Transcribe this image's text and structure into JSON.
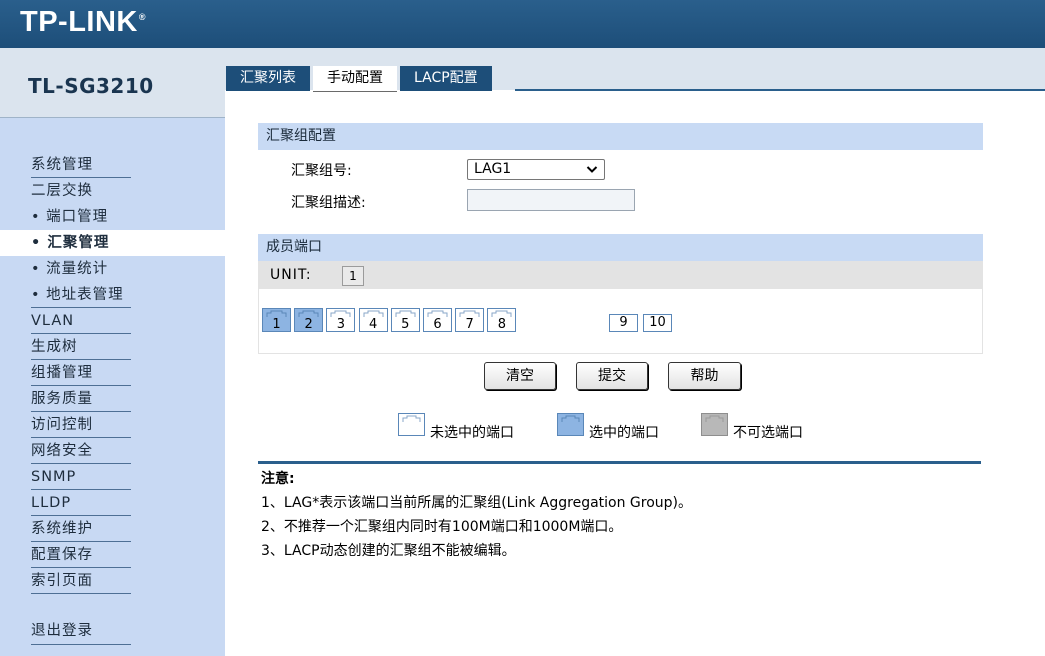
{
  "header": {
    "logo": "TP-LINK",
    "logo_mark": "®",
    "bg_color": "#1d4e79"
  },
  "device": {
    "model": "TL-SG3210"
  },
  "sidebar": {
    "items": [
      {
        "label": "系统管理"
      },
      {
        "label": "二层交换"
      },
      {
        "label": "端口管理",
        "sub": true
      },
      {
        "label": "汇聚管理",
        "sub": true,
        "active": true
      },
      {
        "label": "流量统计",
        "sub": true
      },
      {
        "label": "地址表管理",
        "sub": true
      },
      {
        "label": "VLAN"
      },
      {
        "label": "生成树"
      },
      {
        "label": "组播管理"
      },
      {
        "label": "服务质量"
      },
      {
        "label": "访问控制"
      },
      {
        "label": "网络安全"
      },
      {
        "label": "SNMP"
      },
      {
        "label": "LLDP"
      },
      {
        "label": "系统维护"
      },
      {
        "label": "配置保存"
      },
      {
        "label": "索引页面"
      }
    ],
    "logout": "退出登录",
    "bullet": "•"
  },
  "tabs": [
    {
      "label": "汇聚列表"
    },
    {
      "label": "手动配置",
      "active": true
    },
    {
      "label": "LACP配置"
    }
  ],
  "group_config": {
    "header": "汇聚组配置",
    "id_label": "汇聚组号:",
    "id_value": "LAG1",
    "desc_label": "汇聚组描述:",
    "desc_value": ""
  },
  "members": {
    "header": "成员端口",
    "unit_label": "UNIT:",
    "unit_value": "1",
    "ports": [
      {
        "num": "1",
        "selected": true
      },
      {
        "num": "2",
        "selected": true
      },
      {
        "num": "3",
        "selected": false
      },
      {
        "num": "4",
        "selected": false
      },
      {
        "num": "5",
        "selected": false
      },
      {
        "num": "6",
        "selected": false
      },
      {
        "num": "7",
        "selected": false
      },
      {
        "num": "8",
        "selected": false
      }
    ],
    "sfp_ports": [
      "9",
      "10"
    ]
  },
  "buttons": {
    "clear": "清空",
    "submit": "提交",
    "help": "帮助"
  },
  "legend": {
    "unselected": "未选中的端口",
    "selected": "选中的端口",
    "unavailable": "不可选端口"
  },
  "notes": {
    "title": "注意:",
    "items": [
      "1、LAG*表示该端口当前所属的汇聚组(Link Aggregation Group)。",
      "2、不推荐一个汇聚组内同时有100M端口和1000M端口。",
      "3、LACP动态创建的汇聚组不能被编辑。"
    ]
  },
  "colors": {
    "accent": "#1d4e79",
    "sidebar_bg": "#c8d9f3",
    "section_bg": "#c8daf4",
    "port_selected": "#8db4e2",
    "port_unavailable": "#b8b8b8"
  }
}
